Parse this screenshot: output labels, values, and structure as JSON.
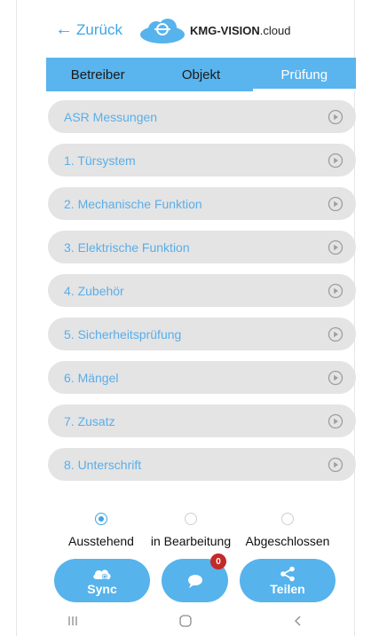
{
  "header": {
    "back_label": "Zurück",
    "brand_bold": "KMG-VISION",
    "brand_suffix": ".cloud"
  },
  "tabs": [
    {
      "label": "Betreiber",
      "active": false
    },
    {
      "label": "Objekt",
      "active": false
    },
    {
      "label": "Prüfung",
      "active": true
    }
  ],
  "sections": [
    {
      "label": "ASR Messungen"
    },
    {
      "label": "1. Türsystem"
    },
    {
      "label": "2. Mechanische Funktion"
    },
    {
      "label": "3. Elektrische Funktion"
    },
    {
      "label": "4. Zubehör"
    },
    {
      "label": "5. Sicherheitsprüfung"
    },
    {
      "label": "6. Mängel"
    },
    {
      "label": "7. Zusatz"
    },
    {
      "label": "8. Unterschrift"
    }
  ],
  "status_options": [
    {
      "label": "Ausstehend",
      "selected": true
    },
    {
      "label": "in Bearbeitung",
      "selected": false
    },
    {
      "label": "Abgeschlossen",
      "selected": false
    }
  ],
  "actions": {
    "sync_label": "Sync",
    "chat_badge": "0",
    "share_label": "Teilen"
  },
  "colors": {
    "accent": "#56b3ec",
    "section_text": "#5aaeea",
    "section_bg": "#e4e4e4",
    "badge": "#c62828"
  }
}
